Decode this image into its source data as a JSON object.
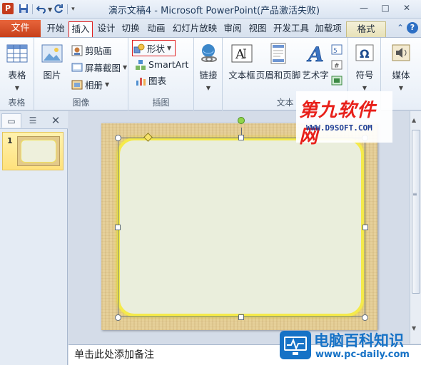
{
  "window": {
    "app_icon": "P",
    "title": "演示文稿4 - Microsoft PowerPoint(产品激活失败)",
    "controls": [
      "—",
      "□",
      "✕"
    ]
  },
  "qat": {
    "save_icon": "save-icon",
    "undo_icon": "undo-icon",
    "redo_icon": "redo-icon",
    "customize_icon": "customize-qat-icon"
  },
  "tabs": {
    "file": "文件",
    "items": [
      "开始",
      "插入",
      "设计",
      "切换",
      "动画",
      "幻灯片放映",
      "审阅",
      "视图",
      "开发工具",
      "加载项",
      "格式"
    ],
    "active": "插入"
  },
  "ribbon": {
    "groups": {
      "tables": {
        "label": "表格",
        "table_btn": "表格"
      },
      "images": {
        "label": "图像",
        "picture_btn": "图片",
        "clipart_btn": "剪贴画",
        "screenshot_btn": "屏幕截图",
        "album_btn": "相册"
      },
      "illustrations": {
        "label": "插图",
        "shapes_btn": "形状",
        "smartart_btn": "SmartArt",
        "chart_btn": "图表"
      },
      "links": {
        "link_btn": "链接"
      },
      "text": {
        "label": "文本",
        "textbox_btn": "文本框",
        "header_btn": "页眉和页脚",
        "wordart_btn": "艺术字"
      },
      "symbols": {
        "symbol_btn": "符号"
      },
      "media": {
        "media_btn": "媒体"
      }
    }
  },
  "slides_panel": {
    "thumb_number": "1"
  },
  "notes": {
    "placeholder": "单击此处添加备注"
  },
  "watermarks": {
    "top_cn": "第九软件网",
    "top_url": "WWW.D9SOFT.COM",
    "bottom_cn": "电脑百科知识",
    "bottom_url": "www.pc-daily.com"
  },
  "colors": {
    "file_tab": "#c7401b",
    "highlight_box": "#e02020",
    "shape_fill": "#eaeedc",
    "shape_glow": "#f5ea4a",
    "slide_bg": "#e6d09a"
  }
}
